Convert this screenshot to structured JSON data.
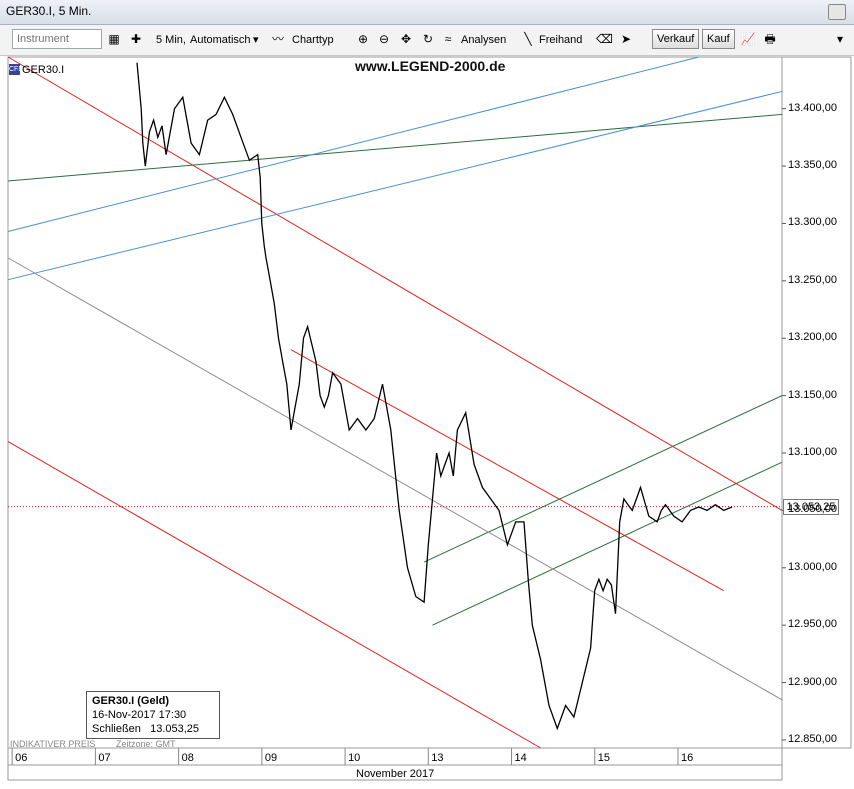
{
  "window": {
    "title": "GER30.I, 5 Min."
  },
  "toolbar": {
    "instrument_placeholder": "Instrument",
    "interval_label": "5 Min,",
    "scale_label": "Automatisch",
    "charttype_label": "Charttyp",
    "analysen_label": "Analysen",
    "freihand_label": "Freihand",
    "sell_label": "Verkauf",
    "buy_label": "Kauf"
  },
  "chart_header": {
    "symbol": "GER30.I",
    "watermark": "www.LEGEND-2000.de"
  },
  "info_box": {
    "title": "GER30.I (Geld)",
    "datetime": "16-Nov-2017 17:30",
    "close_label": "Schließen",
    "close_value": "13.053,25"
  },
  "footer": {
    "indicator_text": "INDIKATIVER PREIS",
    "timezone_text": "Zeitzone: GMT"
  },
  "current_price_label": "13.053,25",
  "colors": {
    "price": "#000000",
    "red_line": "#e0231c",
    "green_line": "#2e6e3a",
    "blue_line": "#4a8fd0",
    "gray_line": "#8c8c8c"
  },
  "chart_data": {
    "type": "line",
    "title": "",
    "xlabel": "November 2017",
    "ylabel": "",
    "x_ticks": [
      "06",
      "07",
      "08",
      "09",
      "10",
      "13",
      "14",
      "15",
      "16"
    ],
    "y_ticks": [
      "12.850,00",
      "12.900,00",
      "12.950,00",
      "13.000,00",
      "13.050,00",
      "13.100,00",
      "13.150,00",
      "13.200,00",
      "13.250,00",
      "13.300,00",
      "13.350,00",
      "13.400,00"
    ],
    "ylim": [
      12843,
      13445
    ],
    "xlim": [
      0,
      9.3
    ],
    "current_price": 13053.25,
    "series": [
      {
        "x": [
          1.55,
          1.6,
          1.62,
          1.65,
          1.7,
          1.75,
          1.8,
          1.85,
          1.9,
          2.0,
          2.1,
          2.2,
          2.3,
          2.4,
          2.5,
          2.6,
          2.7,
          2.8,
          2.9,
          3.0,
          3.03,
          3.05,
          3.08,
          3.1,
          3.15,
          3.2,
          3.25,
          3.3,
          3.35,
          3.4,
          3.45,
          3.5,
          3.55,
          3.6,
          3.7,
          3.75,
          3.8,
          3.85,
          3.9,
          4.0,
          4.1,
          4.2,
          4.3,
          4.4,
          4.5,
          4.6,
          4.7,
          4.8,
          4.9,
          5.0,
          5.05,
          5.1,
          5.15,
          5.2,
          5.25,
          5.3,
          5.35,
          5.4,
          5.5,
          5.6,
          5.7,
          5.8,
          5.9,
          6.0,
          6.1,
          6.2,
          6.25,
          6.3,
          6.4,
          6.5,
          6.6,
          6.7,
          6.8,
          6.9,
          7.0,
          7.05,
          7.1,
          7.15,
          7.2,
          7.25,
          7.3,
          7.35,
          7.4,
          7.45,
          7.5,
          7.55,
          7.6,
          7.7,
          7.8,
          7.85,
          7.9,
          8.0,
          8.1,
          8.2,
          8.3,
          8.4,
          8.5,
          8.6,
          8.7
        ],
        "y": [
          13440,
          13400,
          13370,
          13350,
          13380,
          13390,
          13375,
          13385,
          13360,
          13400,
          13410,
          13370,
          13360,
          13390,
          13395,
          13410,
          13395,
          13375,
          13355,
          13360,
          13340,
          13300,
          13280,
          13270,
          13250,
          13230,
          13200,
          13180,
          13160,
          13120,
          13140,
          13160,
          13200,
          13210,
          13180,
          13150,
          13140,
          13150,
          13170,
          13160,
          13120,
          13130,
          13120,
          13130,
          13160,
          13120,
          13050,
          13000,
          12975,
          12970,
          13020,
          13060,
          13100,
          13080,
          13090,
          13100,
          13080,
          13120,
          13135,
          13090,
          13070,
          13060,
          13050,
          13020,
          13040,
          13040,
          12990,
          12950,
          12920,
          12880,
          12860,
          12880,
          12870,
          12900,
          12930,
          12980,
          12990,
          12980,
          12990,
          12985,
          12960,
          13040,
          13060,
          13055,
          13050,
          13060,
          13070,
          13045,
          13040,
          13050,
          13055,
          13045,
          13040,
          13050,
          13053,
          13050,
          13055,
          13050,
          13053
        ]
      }
    ]
  }
}
